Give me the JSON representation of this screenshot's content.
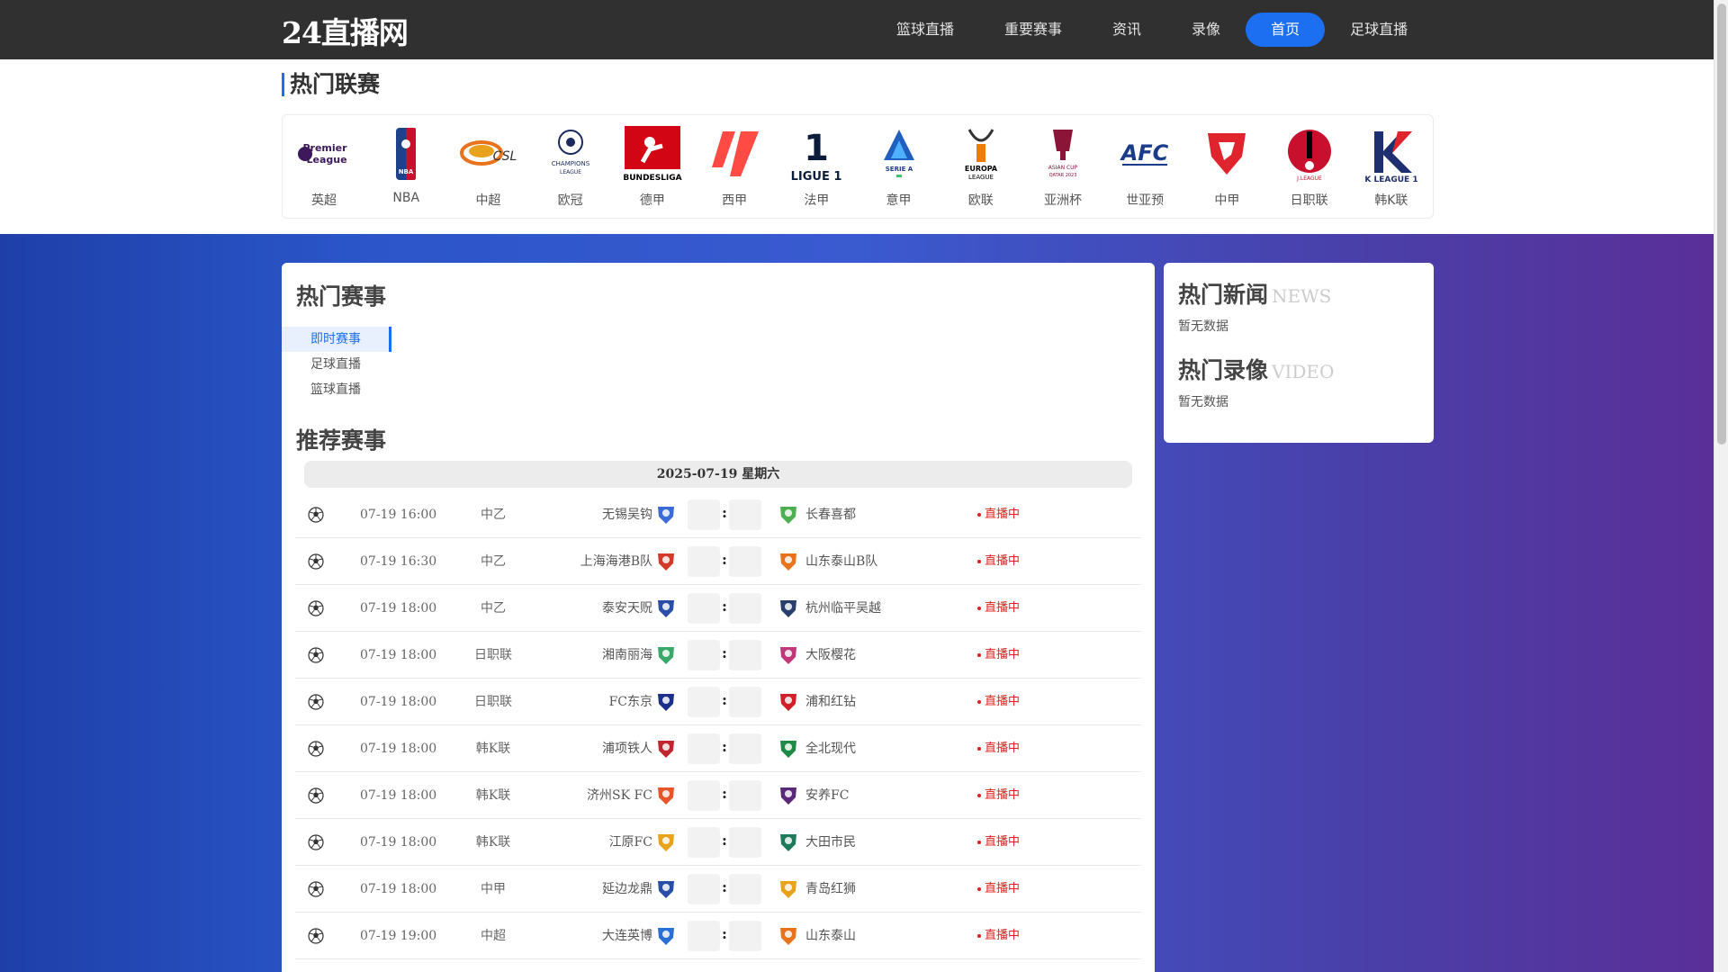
{
  "header": {
    "logo": "24直播网",
    "nav": [
      {
        "label": "篮球直播",
        "active": false
      },
      {
        "label": "重要赛事",
        "active": false
      },
      {
        "label": "资讯",
        "active": false
      },
      {
        "label": "录像",
        "active": false
      },
      {
        "label": "首页",
        "active": true
      },
      {
        "label": "足球直播",
        "active": false
      }
    ]
  },
  "leagues": {
    "title": "热门联赛",
    "items": [
      {
        "name": "英超",
        "icon": "premier-league-logo-icon",
        "text": "Premier League"
      },
      {
        "name": "NBA",
        "icon": "nba-logo-icon",
        "text": "NBA"
      },
      {
        "name": "中超",
        "icon": "csl-logo-icon",
        "text": "CSL"
      },
      {
        "name": "欧冠",
        "icon": "champions-league-logo-icon",
        "text": "CHAMPIONS LEAGUE"
      },
      {
        "name": "德甲",
        "icon": "bundesliga-logo-icon",
        "text": "BUNDESLIGA"
      },
      {
        "name": "西甲",
        "icon": "laliga-logo-icon",
        "text": ""
      },
      {
        "name": "法甲",
        "icon": "ligue1-logo-icon",
        "text": "LIGUE 1"
      },
      {
        "name": "意甲",
        "icon": "serie-a-logo-icon",
        "text": "SERIE A"
      },
      {
        "name": "欧联",
        "icon": "europa-league-logo-icon",
        "text": "EUROPA LEAGUE"
      },
      {
        "name": "亚洲杯",
        "icon": "asian-cup-logo-icon",
        "text": "ASIAN CUP"
      },
      {
        "name": "世亚预",
        "icon": "afc-logo-icon",
        "text": "AFC"
      },
      {
        "name": "中甲",
        "icon": "china-league-one-logo-icon",
        "text": ""
      },
      {
        "name": "日职联",
        "icon": "j-league-logo-icon",
        "text": "J.LEAGUE"
      },
      {
        "name": "韩K联",
        "icon": "k-league-logo-icon",
        "text": "K LEAGUE 1"
      }
    ]
  },
  "hot_matches": {
    "title": "热门赛事",
    "tabs": [
      {
        "label": "即时赛事",
        "active": true
      },
      {
        "label": "足球直播",
        "active": false
      },
      {
        "label": "篮球直播",
        "active": false
      }
    ]
  },
  "recommended": {
    "title": "推荐赛事",
    "date": "2025-07-19 星期六",
    "score_separator": ":",
    "matches": [
      {
        "time": "07-19 16:00",
        "league": "中乙",
        "home": "无锡吴钩",
        "away": "长春喜都",
        "status": "直播中",
        "home_color": "#3b6bd6",
        "away_color": "#4caf50"
      },
      {
        "time": "07-19 16:30",
        "league": "中乙",
        "home": "上海海港B队",
        "away": "山东泰山B队",
        "status": "直播中",
        "home_color": "#d43a2a",
        "away_color": "#e8731c"
      },
      {
        "time": "07-19 18:00",
        "league": "中乙",
        "home": "泰安天贶",
        "away": "杭州临平吴越",
        "status": "直播中",
        "home_color": "#2b4fa8",
        "away_color": "#2a3f6e"
      },
      {
        "time": "07-19 18:00",
        "league": "日职联",
        "home": "湘南丽海",
        "away": "大阪樱花",
        "status": "直播中",
        "home_color": "#3aa86b",
        "away_color": "#c2367a"
      },
      {
        "time": "07-19 18:00",
        "league": "日职联",
        "home": "FC东京",
        "away": "浦和红钻",
        "status": "直播中",
        "home_color": "#1c2f8a",
        "away_color": "#d11f2a"
      },
      {
        "time": "07-19 18:00",
        "league": "韩K联",
        "home": "浦项铁人",
        "away": "全北现代",
        "status": "直播中",
        "home_color": "#c0262d",
        "away_color": "#1e8a46"
      },
      {
        "time": "07-19 18:00",
        "league": "韩K联",
        "home": "济州SK FC",
        "away": "安养FC",
        "status": "直播中",
        "home_color": "#e8552a",
        "away_color": "#5a2a7a"
      },
      {
        "time": "07-19 18:00",
        "league": "韩K联",
        "home": "江原FC",
        "away": "大田市民",
        "status": "直播中",
        "home_color": "#e8a21c",
        "away_color": "#1e7a5a"
      },
      {
        "time": "07-19 18:00",
        "league": "中甲",
        "home": "延边龙鼎",
        "away": "青岛红狮",
        "status": "直播中",
        "home_color": "#2a4fa8",
        "away_color": "#e8a21c"
      },
      {
        "time": "07-19 19:00",
        "league": "中超",
        "home": "大连英博",
        "away": "山东泰山",
        "status": "直播中",
        "home_color": "#2a6fd6",
        "away_color": "#e8731c"
      }
    ]
  },
  "side": {
    "news_title": "热门新闻",
    "news_title_en": "NEWS",
    "news_empty": "暂无数据",
    "video_title": "热门录像",
    "video_title_en": "VIDEO",
    "video_empty": "暂无数据"
  },
  "colors": {
    "accent": "#1d6ff2",
    "header_bg": "#303030",
    "live": "#e02020"
  }
}
